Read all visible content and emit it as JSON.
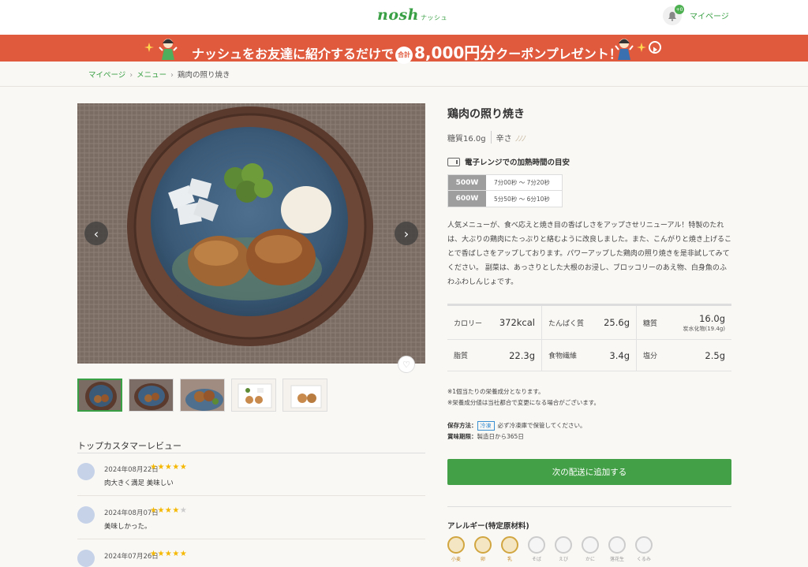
{
  "header": {
    "logo_text": "nosh",
    "logo_kana": "ナッシュ",
    "notification_count": "+0",
    "mypage_label": "マイページ"
  },
  "banner": {
    "text_pre": "ナッシュをお友達に紹介するだけで",
    "badge": "合計",
    "amount": "8,000円分",
    "text_post": "クーポンプレゼント！"
  },
  "breadcrumb": {
    "items": [
      "マイページ",
      "メニュー",
      "鶏肉の照り焼き"
    ]
  },
  "product": {
    "title": "鶏肉の照り焼き",
    "sugar": "糖質16.0g",
    "spice_label": "辛さ",
    "spice_icons": "ﾉﾉﾉ",
    "microwave_heading": "電子レンジでの加熱時間の目安",
    "microwave": [
      {
        "watt": "500W",
        "time": "7分00秒 〜 7分20秒"
      },
      {
        "watt": "600W",
        "time": "5分50秒 〜 6分10秒"
      }
    ],
    "description": "人気メニューが、食べ応えと焼き目の香ばしさをアップさせリニューアル！特製のたれは、大ぶりの鶏肉にたっぷりと絡むように改良しました。また、こんがりと焼き上げることで香ばしさをアップしております。パワーアップした鶏肉の照り焼きを是非試してみてください。 副菜は、あっさりとした大根のお浸し、ブロッコリーのあえ物、白身魚のふわふわしんじょです。",
    "nutrition": [
      [
        {
          "name": "カロリー",
          "value": "372kcal"
        },
        {
          "name": "たんぱく質",
          "value": "25.6g"
        },
        {
          "name": "糖質",
          "value": "16.0g",
          "sub": "炭水化物(19.4g)"
        }
      ],
      [
        {
          "name": "脂質",
          "value": "22.3g"
        },
        {
          "name": "食物繊維",
          "value": "3.4g"
        },
        {
          "name": "塩分",
          "value": "2.5g"
        }
      ]
    ],
    "notes": [
      "※1個当たりの栄養成分となります。",
      "※栄養成分値は当社都合で変更になる場合がございます。"
    ],
    "storage_label": "保存方法：",
    "storage_tag": "冷凍",
    "storage_text": "必ず冷凍庫で保管してください。",
    "expiry_label": "賞味期限：",
    "expiry_text": "製造日から365日",
    "add_button": "次の配送に追加する",
    "allergy_title": "アレルギー(特定原材料)",
    "allergens": [
      {
        "label": "小麦",
        "active": true
      },
      {
        "label": "卵",
        "active": true
      },
      {
        "label": "乳",
        "active": true
      },
      {
        "label": "そば",
        "active": false
      },
      {
        "label": "えび",
        "active": false
      },
      {
        "label": "かに",
        "active": false
      },
      {
        "label": "落花生",
        "active": false
      },
      {
        "label": "くるみ",
        "active": false
      }
    ]
  },
  "reviews": {
    "title": "トップカスタマーレビュー",
    "items": [
      {
        "date": "2024年08月22日",
        "stars": 5,
        "text": "肉大きく満足 美味しい"
      },
      {
        "date": "2024年08月07日",
        "stars": 4,
        "text": "美味しかった。"
      },
      {
        "date": "2024年07月26日",
        "stars": 5,
        "text": ""
      }
    ]
  },
  "colors": {
    "brand_green": "#3aa045",
    "banner_red": "#e05a3e",
    "button_green": "#43a047",
    "star_gold": "#f5b800"
  }
}
